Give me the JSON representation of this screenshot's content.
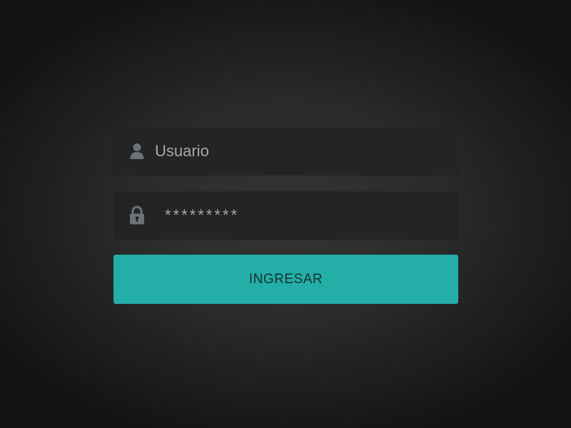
{
  "login": {
    "username": {
      "placeholder": "Usuario",
      "icon": "user-icon"
    },
    "password": {
      "placeholder": "*********",
      "icon": "lock-icon"
    },
    "submit_label": "INGRESAR"
  },
  "colors": {
    "accent": "#24aea8",
    "field_background": "#222425",
    "text": "#a6a9aa",
    "icon": "#6f7274"
  }
}
